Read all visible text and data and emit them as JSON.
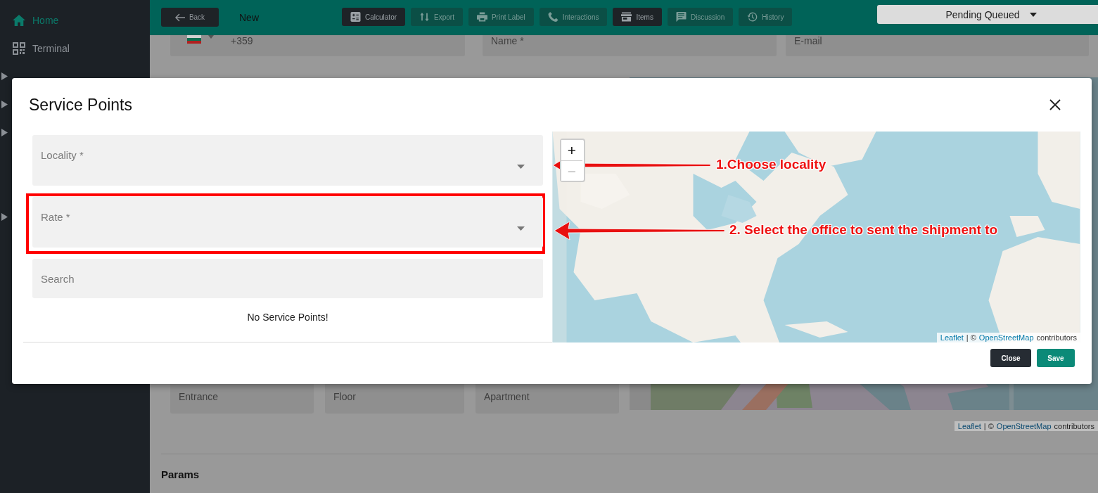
{
  "sidebar": {
    "items": [
      {
        "label": "Home",
        "selected": true,
        "expandable": false
      },
      {
        "label": "Terminal",
        "selected": false,
        "expandable": false
      },
      {
        "expandable": true
      },
      {
        "expandable": true
      },
      {
        "expandable": true
      },
      {
        "expandable": true
      }
    ]
  },
  "top_bar": {
    "back_button": "Back",
    "record_title": "New",
    "toolbar": [
      {
        "label": "Calculator",
        "active": true
      },
      {
        "label": "Export",
        "active": false
      },
      {
        "label": "Print Label",
        "active": false
      },
      {
        "label": "Interactions",
        "active": false
      },
      {
        "label": "Items",
        "active": true
      },
      {
        "label": "Discussion",
        "active": false
      },
      {
        "label": "History",
        "active": false
      }
    ],
    "status_dropdown": "Pending Queued"
  },
  "form": {
    "phone_code": "+359",
    "fields": [
      {
        "placeholder": "Name *"
      },
      {
        "placeholder": "E-mail"
      }
    ],
    "address_fields": [
      {
        "placeholder": "Entrance"
      },
      {
        "placeholder": "Floor"
      },
      {
        "placeholder": "Apartment"
      }
    ],
    "map": {
      "kind": "picture",
      "attribution": [
        {
          "kind": "link",
          "text": "Leaflet"
        },
        {
          "kind": "text",
          "text": "| ©"
        },
        {
          "kind": "link",
          "text": "OpenStreetMap"
        },
        {
          "kind": "text",
          "text": "contributors"
        }
      ]
    },
    "section_heading": "Params"
  },
  "modal": {
    "title": "Service Points",
    "fields": [
      {
        "kind": "select",
        "label": "Locality *",
        "highlighted": false
      },
      {
        "kind": "select",
        "label": "Rate *",
        "highlighted": true
      },
      {
        "kind": "search",
        "placeholder": "Search",
        "highlighted": false
      }
    ],
    "empty_message": "No Service Points!",
    "map": {
      "kind": "picture",
      "zoom_in": "+",
      "zoom_out": "−",
      "attribution": [
        {
          "kind": "link",
          "text": "Leaflet"
        },
        {
          "kind": "text",
          "text": "| ©"
        },
        {
          "kind": "link",
          "text": "OpenStreetMap"
        },
        {
          "kind": "text",
          "text": "contributors"
        }
      ]
    },
    "buttons": [
      {
        "label": "Close",
        "kind": "secondary"
      },
      {
        "label": "Save",
        "kind": "primary"
      }
    ],
    "annotations": [
      {
        "text": "1.Choose locality"
      },
      {
        "text": "2. Select the office to sent the shipment to"
      }
    ]
  }
}
